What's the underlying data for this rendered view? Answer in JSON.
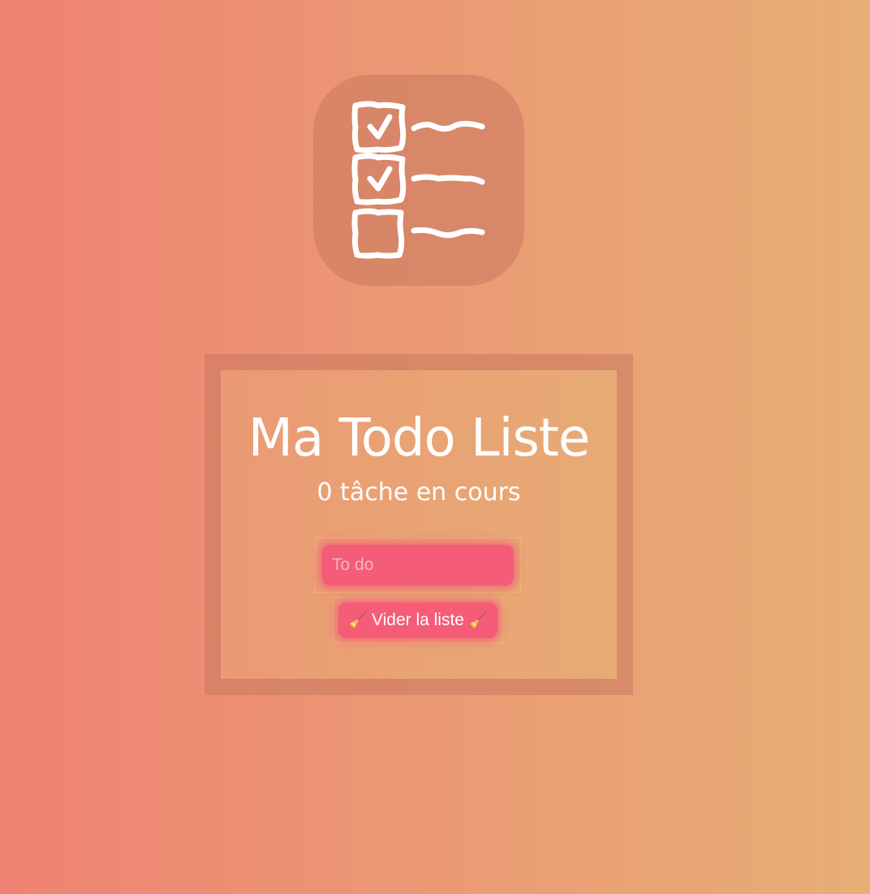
{
  "app": {
    "logo_icon": "checklist-icon"
  },
  "card": {
    "title": "Ma Todo Liste",
    "counter": "0 tâche en cours"
  },
  "todo_input": {
    "placeholder": "To do",
    "value": ""
  },
  "clear_button": {
    "label": "Vider la liste",
    "icon": "broom-icon",
    "icon_glyph": "🧹"
  },
  "colors": {
    "gradient_start": "#ef8272",
    "gradient_end": "#e7ae75",
    "accent": "#f45c78",
    "text": "#ffffff"
  }
}
